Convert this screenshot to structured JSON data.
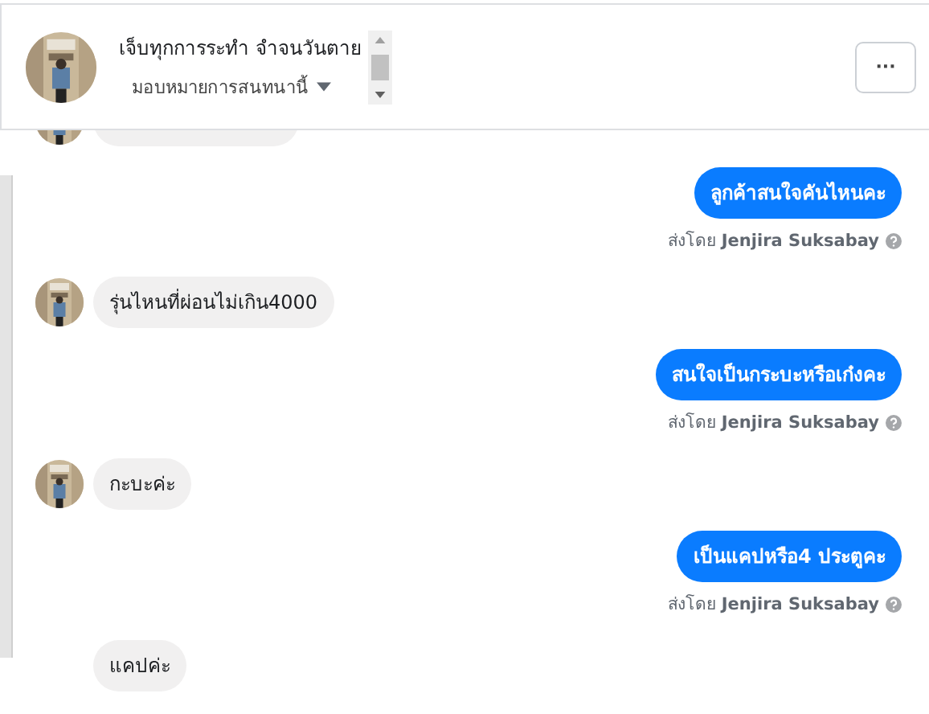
{
  "header": {
    "name": "เจ็บทุกการระทำ จำจนวันตาย",
    "assign": "มอบหมายการสนทนานี้",
    "more": "···"
  },
  "messages": [
    {
      "kind": "incoming",
      "avatar": true
    },
    {
      "kind": "outgoing",
      "text": "ลูกค้าสนใจคันไหนคะ",
      "sent_by": "ส่งโดย **Jenjira Suksabay**"
    },
    {
      "kind": "incoming",
      "avatar": true,
      "text": "รุ่นไหนที่ผ่อนไม่เกิน4000"
    },
    {
      "kind": "outgoing",
      "text": "สนใจเป็นกระบะหรือเก๋งคะ",
      "sent_by": "ส่งโดย **Jenjira Suksabay**"
    },
    {
      "kind": "incoming",
      "avatar": true,
      "text": "กะบะค่ะ"
    },
    {
      "kind": "outgoing",
      "text": "เป็นแคปหรือ4 ประตูคะ",
      "sent_by": "ส่งโดย **Jenjira Suksabay**"
    },
    {
      "kind": "incoming",
      "avatar": false,
      "text": "แคปค่ะ"
    }
  ]
}
